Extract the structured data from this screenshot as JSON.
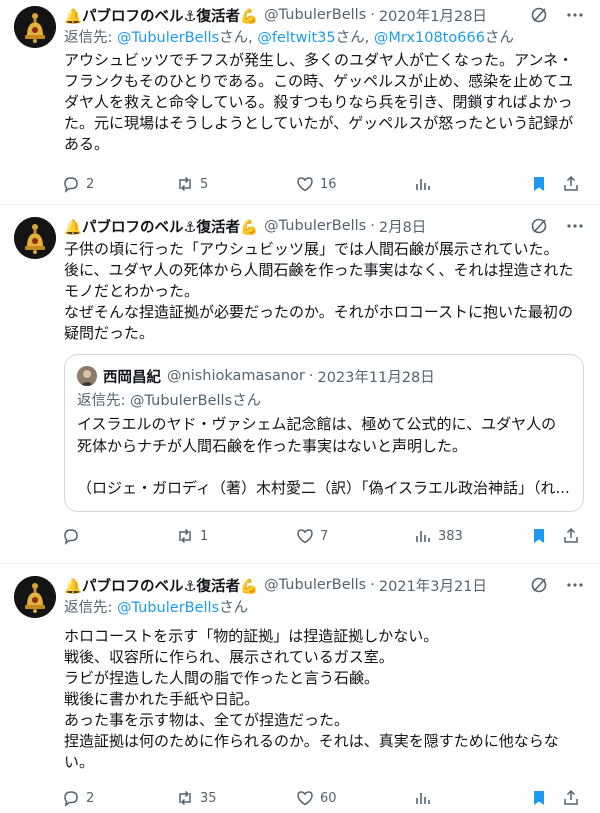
{
  "tweets": [
    {
      "name": "🔔パブロフのベル⚓復活者💪",
      "handle": "@TubulerBells",
      "date": "2020年1月28日",
      "reply_prefix": "返信先: ",
      "reply_users": [
        "@TubulerBells",
        "@feltwit35",
        "@Mrx108to666"
      ],
      "reply_sep": "さん, ",
      "reply_suffix": "さん",
      "body": "アウシュビッツでチフスが発生し、多くのユダヤ人が亡くなった。アンネ・フランクもそのひとりである。この時、ゲッペルスが止め、感染を止めてユダヤ人を救えと命令している。殺すつもりなら兵を引き、閉鎖すればよかった。元に現場はそうしようとしていたが、ゲッペルスが怒ったという記録がある。",
      "replies": "2",
      "retweets": "5",
      "likes": "16",
      "views": ""
    },
    {
      "name": "🔔パブロフのベル⚓復活者💪",
      "handle": "@TubulerBells",
      "date": "2月8日",
      "body": "子供の頃に行った「アウシュビッツ展」では人間石鹸が展示されていた。\n後に、ユダヤ人の死体から人間石鹸を作った事実はなく、それは捏造されたモノだとわかった。\nなぜそんな捏造証拠が必要だったのか。それがホロコーストに抱いた最初の疑問だった。",
      "quote": {
        "name": "西岡昌紀",
        "handle": "@nishiokamasanor",
        "date": "2023年11月28日",
        "reply": "返信先: @TubulerBellsさん",
        "body": "イスラエルのヤド・ヴァシェム記念館は、極めて公式的に、ユダヤ人の死体からナチが人間石鹸を作った事実はないと声明した。",
        "body2": "（ロジェ・ガロディ（著）木村愛二（訳）「偽イスラエル政治神話」（れ..."
      },
      "replies": "",
      "retweets": "1",
      "likes": "7",
      "views": "383"
    },
    {
      "name": "🔔パブロフのベル⚓復活者💪",
      "handle": "@TubulerBells",
      "date": "2021年3月21日",
      "reply_prefix": "返信先: ",
      "reply_users": [
        "@TubulerBells"
      ],
      "reply_sep": "さん, ",
      "reply_suffix": "さん",
      "body": "ホロコーストを示す「物的証拠」は捏造証拠しかない。\n戦後、収容所に作られ、展示されているガス室。\nラビが捏造した人間の脂で作ったと言う石鹸。\n戦後に書かれた手紙や日記。\nあった事を示す物は、全てが捏造だった。\n捏造証拠は何のために作られるのか。それは、真実を隠すために他ならない。",
      "replies": "2",
      "retweets": "35",
      "likes": "60",
      "views": ""
    }
  ],
  "dot": "·",
  "colors": {
    "accent": "#1d9bf0",
    "muted": "#536471",
    "text": "#0f1419",
    "bookmark": "#1d9bf0"
  }
}
